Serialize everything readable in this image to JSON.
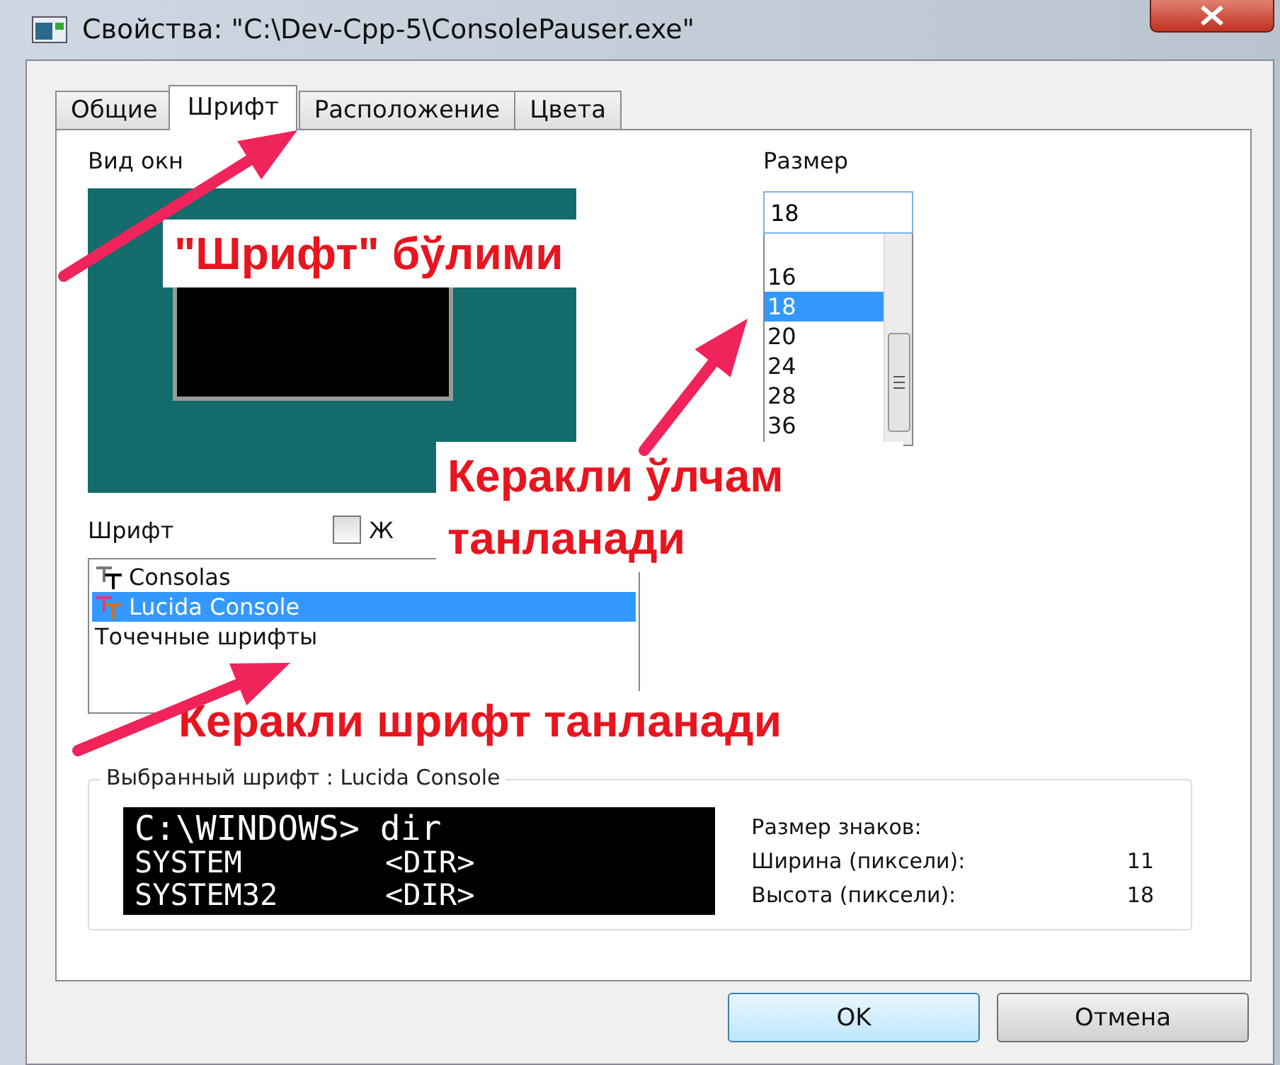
{
  "window": {
    "title": "Свойства: \"C:\\Dev-Cpp-5\\ConsolePauser.exe\""
  },
  "tabs": [
    {
      "label": "Общие",
      "selected": false
    },
    {
      "label": "Шрифт",
      "selected": true
    },
    {
      "label": "Расположение",
      "selected": false
    },
    {
      "label": "Цвета",
      "selected": false
    }
  ],
  "window_preview": {
    "label": "Вид окн"
  },
  "size": {
    "label": "Размер",
    "value": "18",
    "options": [
      {
        "label": "16",
        "selected": false
      },
      {
        "label": "18",
        "selected": true
      },
      {
        "label": "20",
        "selected": false
      },
      {
        "label": "24",
        "selected": false
      },
      {
        "label": "28",
        "selected": false
      },
      {
        "label": "36",
        "selected": false
      }
    ]
  },
  "font": {
    "label": "Шрифт",
    "bold_checkbox": {
      "label": "Ж",
      "checked": false
    },
    "options": [
      {
        "label": "Consolas",
        "kind": "truetype",
        "selected": false
      },
      {
        "label": "Lucida Console",
        "kind": "truetype",
        "selected": true
      },
      {
        "label": "Точечные шрифты",
        "kind": "raster",
        "selected": false
      }
    ]
  },
  "selected_font": {
    "title": "Выбранный шрифт : Lucida Console",
    "preview_lines": [
      "C:\\WINDOWS> dir",
      "SYSTEM        <DIR>",
      "SYSTEM32      <DIR>"
    ],
    "size_heading": "Размер знаков:",
    "metrics": [
      {
        "label": "Ширина (пиксели):",
        "value": "11"
      },
      {
        "label": "Высота (пиксели):",
        "value": "18"
      }
    ]
  },
  "buttons": [
    {
      "label": "OK",
      "default": true
    },
    {
      "label": "Отмена",
      "default": false
    }
  ],
  "annotations": [
    {
      "text": "\"Шрифт\" бўлими"
    },
    {
      "text": "Керакли ўлчам танланади"
    },
    {
      "text": "Керакли шрифт танланади"
    }
  ]
}
